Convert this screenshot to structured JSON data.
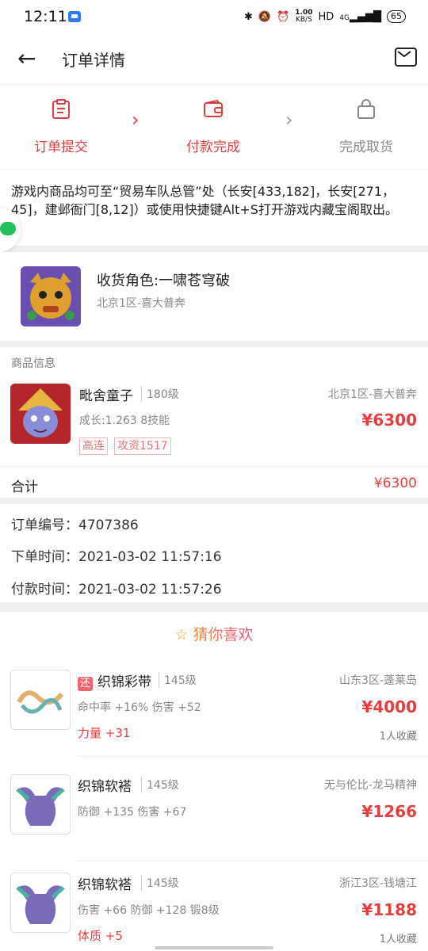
{
  "status_bar": {
    "time": "12:11",
    "net_speed": "1.00",
    "net_unit": "KB/S",
    "hd": "HD",
    "signal": "4G",
    "battery": "65"
  },
  "header": {
    "title": "订单详情"
  },
  "steps": [
    {
      "label": "订单提交",
      "color": "#d94141"
    },
    {
      "label": "付款完成",
      "color": "#d94141"
    },
    {
      "label": "完成取货",
      "color": "#888888"
    }
  ],
  "notice": "游戏内商品均可至“贸易车队总管”处（长安[433,182]，长安[271，45]，建邺衙门[8,12]）或使用快捷键Alt+S打开游戏内藏宝阁取出。",
  "receiver": {
    "role": "收货角色:一啸苍穹破",
    "server": "北京1区-喜大普奔"
  },
  "goods": {
    "section_title": "商品信息",
    "name": "毗舍童子",
    "level": "180级",
    "server": "北京1区-喜大普奔",
    "growth": "成长:1.263 8技能",
    "price": "¥6300",
    "tags": [
      "高连",
      "攻资1517"
    ]
  },
  "total": {
    "label": "合计",
    "value": "¥6300"
  },
  "order": {
    "number": "订单编号：4707386",
    "created": "下单时间：2021-03-02 11:57:16",
    "paid": "付款时间：2021-03-02 11:57:26"
  },
  "recommend": {
    "title": "猜你喜欢",
    "items": [
      {
        "badge": "还",
        "name": "织锦彩带",
        "level": "145级",
        "server": "山东3区-蓬莱岛",
        "attrs": "命中率 +16% 伤害 +52",
        "extra": "力量 +31",
        "price": "¥4000",
        "fav": "1人收藏"
      },
      {
        "badge": "",
        "name": "织锦软褡",
        "level": "145级",
        "server": "无与伦比-龙马精神",
        "attrs": "防御 +135 伤害 +67",
        "extra": "",
        "price": "¥1266",
        "fav": ""
      },
      {
        "badge": "",
        "name": "织锦软褡",
        "level": "145级",
        "server": "浙江3区-钱塘江",
        "attrs": "伤害 +66 防御 +128 锻8级",
        "extra": "体质 +5",
        "price": "¥1188",
        "fav": "1人收藏"
      }
    ]
  },
  "colors": {
    "accent": "#e43f3f",
    "orange": "#f0883a",
    "status_red": "#d94141"
  }
}
